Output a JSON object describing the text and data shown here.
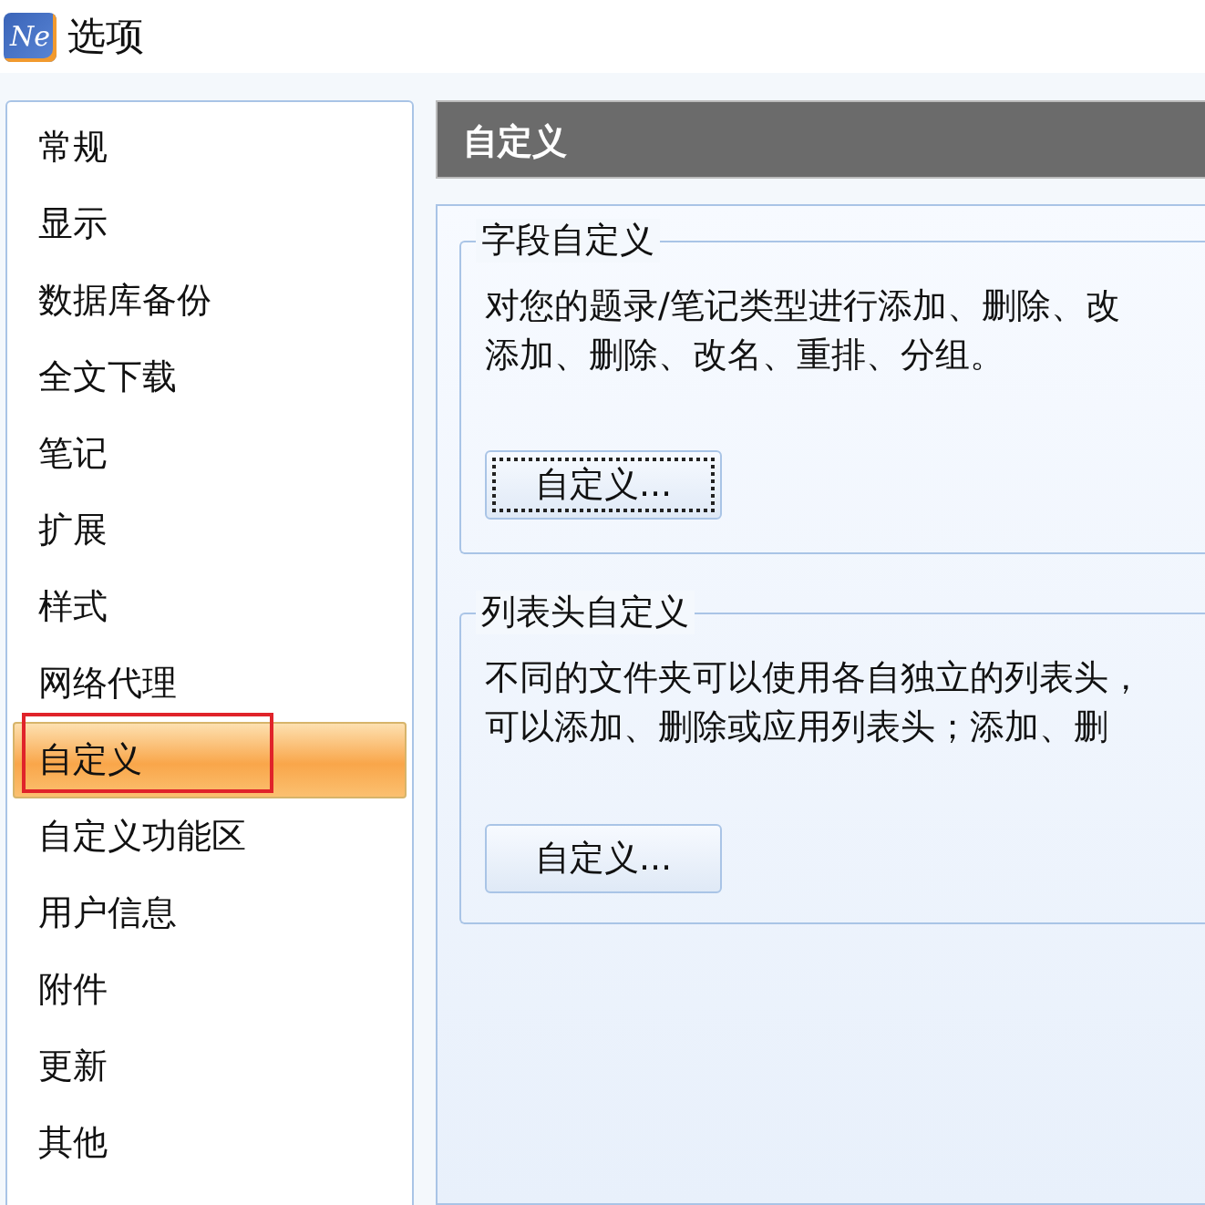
{
  "window": {
    "logo_text": "Ne",
    "title": "选项"
  },
  "sidebar": {
    "items": [
      {
        "label": "常规",
        "selected": false,
        "highlighted": false
      },
      {
        "label": "显示",
        "selected": false,
        "highlighted": false
      },
      {
        "label": "数据库备份",
        "selected": false,
        "highlighted": false
      },
      {
        "label": "全文下载",
        "selected": false,
        "highlighted": false
      },
      {
        "label": "笔记",
        "selected": false,
        "highlighted": false
      },
      {
        "label": "扩展",
        "selected": false,
        "highlighted": false
      },
      {
        "label": "样式",
        "selected": false,
        "highlighted": false
      },
      {
        "label": "网络代理",
        "selected": false,
        "highlighted": false
      },
      {
        "label": "自定义",
        "selected": true,
        "highlighted": true
      },
      {
        "label": "自定义功能区",
        "selected": false,
        "highlighted": false
      },
      {
        "label": "用户信息",
        "selected": false,
        "highlighted": false
      },
      {
        "label": "附件",
        "selected": false,
        "highlighted": false
      },
      {
        "label": "更新",
        "selected": false,
        "highlighted": false
      },
      {
        "label": "其他",
        "selected": false,
        "highlighted": false
      }
    ]
  },
  "panel": {
    "title": "自定义",
    "groups": [
      {
        "title": "字段自定义",
        "lines": [
          "对您的题录/笔记类型进行添加、删除、改",
          "添加、删除、改名、重排、分组。"
        ],
        "button": "自定义...",
        "focused": true
      },
      {
        "title": "列表头自定义",
        "lines": [
          "不同的文件夹可以使用各自独立的列表头，",
          "可以添加、删除或应用列表头；添加、删"
        ],
        "button": "自定义...",
        "focused": false
      }
    ]
  }
}
